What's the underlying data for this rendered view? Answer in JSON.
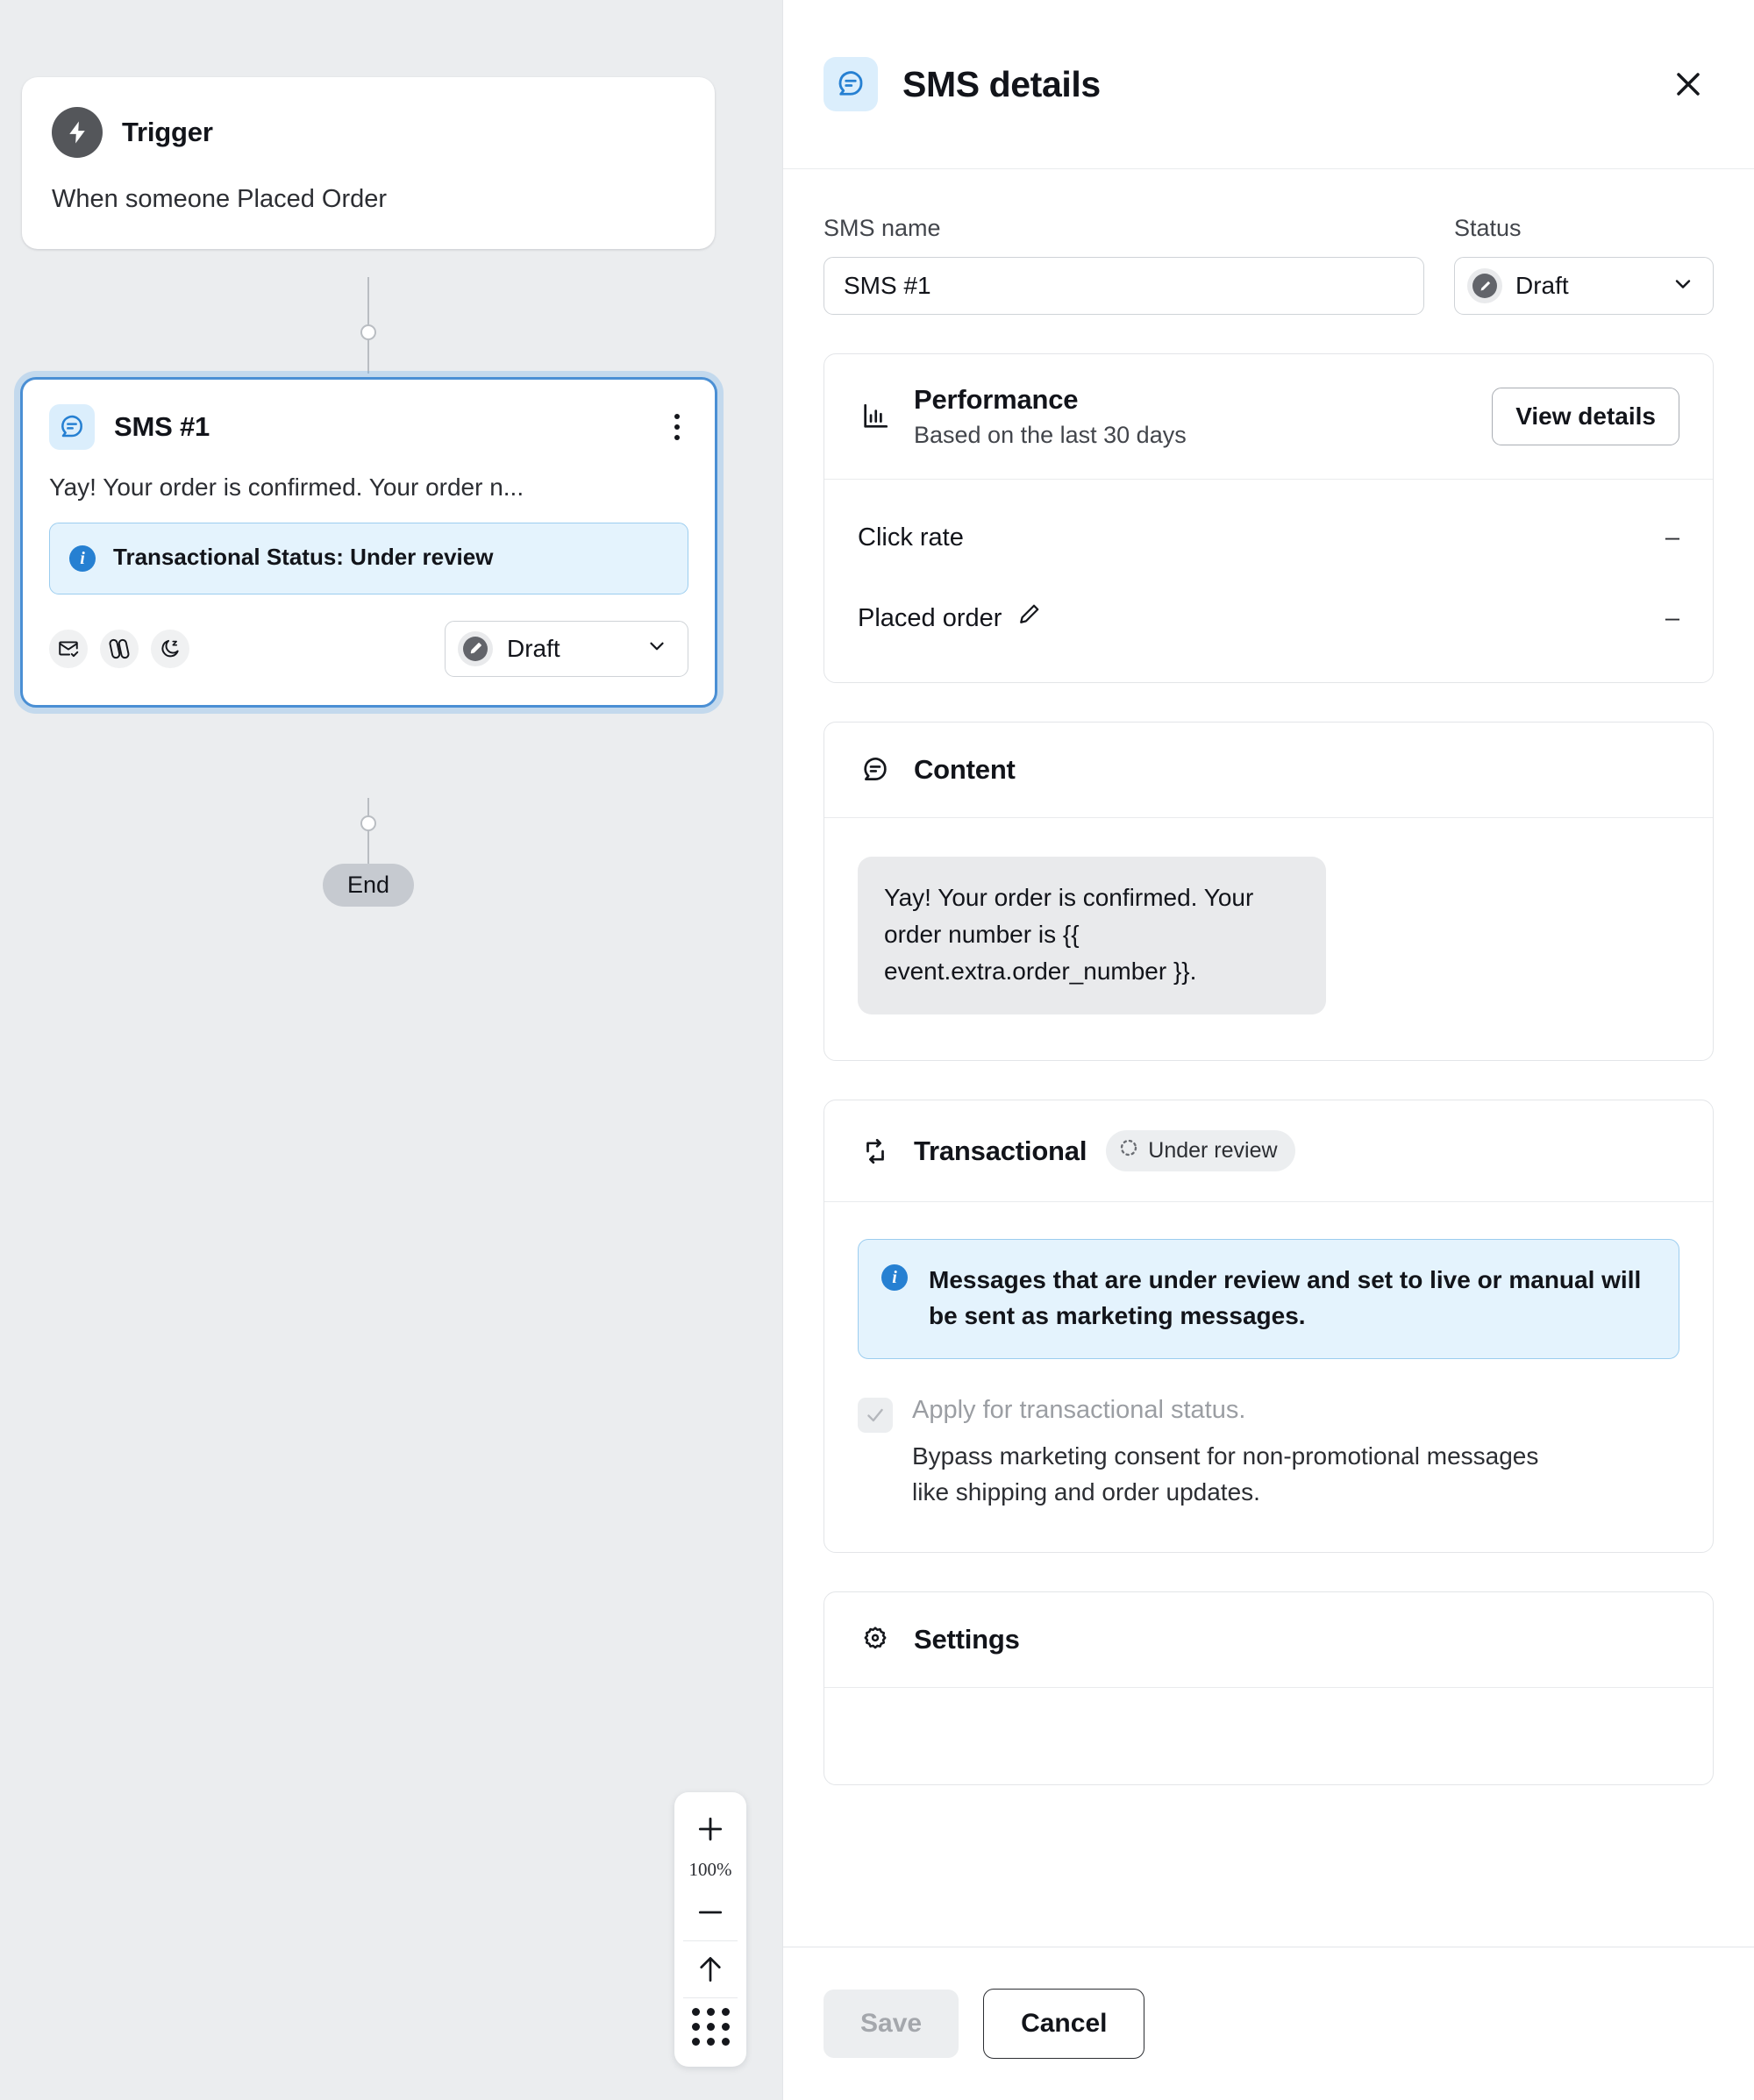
{
  "canvas": {
    "trigger": {
      "icon": "lightning-bolt-icon",
      "title": "Trigger",
      "description": "When someone Placed Order"
    },
    "sms_node": {
      "icon": "sms-message-icon",
      "title": "SMS #1",
      "menu_icon": "kebab-menu-icon",
      "preview": "Yay! Your order is confirmed. Your order n...",
      "alert": {
        "icon": "info-icon",
        "text": "Transactional Status: Under review"
      },
      "chips": [
        {
          "icon": "envelope-check-icon",
          "name": "smart-sending"
        },
        {
          "icon": "link-icon",
          "name": "utm-tracking"
        },
        {
          "icon": "moon-z-icon",
          "name": "quiet-hours"
        }
      ],
      "status": {
        "icon": "draft-pencil-icon",
        "label": "Draft",
        "chevron": "chevron-down-icon"
      }
    },
    "end_label": "End",
    "zoom_controls": {
      "zoom_in": "plus-icon",
      "level": "100%",
      "zoom_out": "minus-icon",
      "fit": "arrow-up-icon",
      "grid": "dot-grid-icon"
    }
  },
  "panel": {
    "header": {
      "icon": "sms-message-icon",
      "title": "SMS details",
      "close": "close-icon"
    },
    "fields": {
      "name_label": "SMS name",
      "name_value": "SMS #1",
      "name_placeholder": "SMS name",
      "status_label": "Status",
      "status_value": "Draft",
      "status_icon": "draft-pencil-icon",
      "status_chevron": "chevron-down-icon"
    },
    "performance": {
      "icon": "bar-chart-icon",
      "title": "Performance",
      "subtitle": "Based on the last 30 days",
      "button": "View details",
      "metrics": [
        {
          "label": "Click rate",
          "value": "–",
          "icon": null
        },
        {
          "label": "Placed order",
          "value": "–",
          "icon": "pencil-edit-icon"
        }
      ]
    },
    "content": {
      "icon": "message-icon",
      "title": "Content",
      "message": "Yay! Your order is confirmed. Your order number is {{ event.extra.order_number }}."
    },
    "transactional": {
      "icon": "repeat-cycle-icon",
      "title": "Transactional",
      "badge_icon": "spinner-dotted-icon",
      "badge_label": "Under review",
      "note_icon": "info-icon",
      "note": "Messages that are under review and set to live or manual will be sent as marketing messages.",
      "checkbox_icon": "check-icon",
      "checkbox_label": "Apply for transactional status.",
      "checkbox_sub": "Bypass marketing consent for non-promotional messages like shipping and order updates."
    },
    "settings": {
      "icon": "gear-icon",
      "title": "Settings"
    },
    "footer": {
      "save": "Save",
      "cancel": "Cancel"
    }
  },
  "colors": {
    "canvas_bg": "#ebedef",
    "accent_blue": "#2680d2",
    "selected_border": "#4a8fd4",
    "info_bg": "#e4f3fd",
    "info_border": "#9ccdef",
    "icon_tint_bg": "#dbeefc",
    "bubble_bg": "#e9eaec",
    "end_pill_bg": "#c6cad0"
  }
}
